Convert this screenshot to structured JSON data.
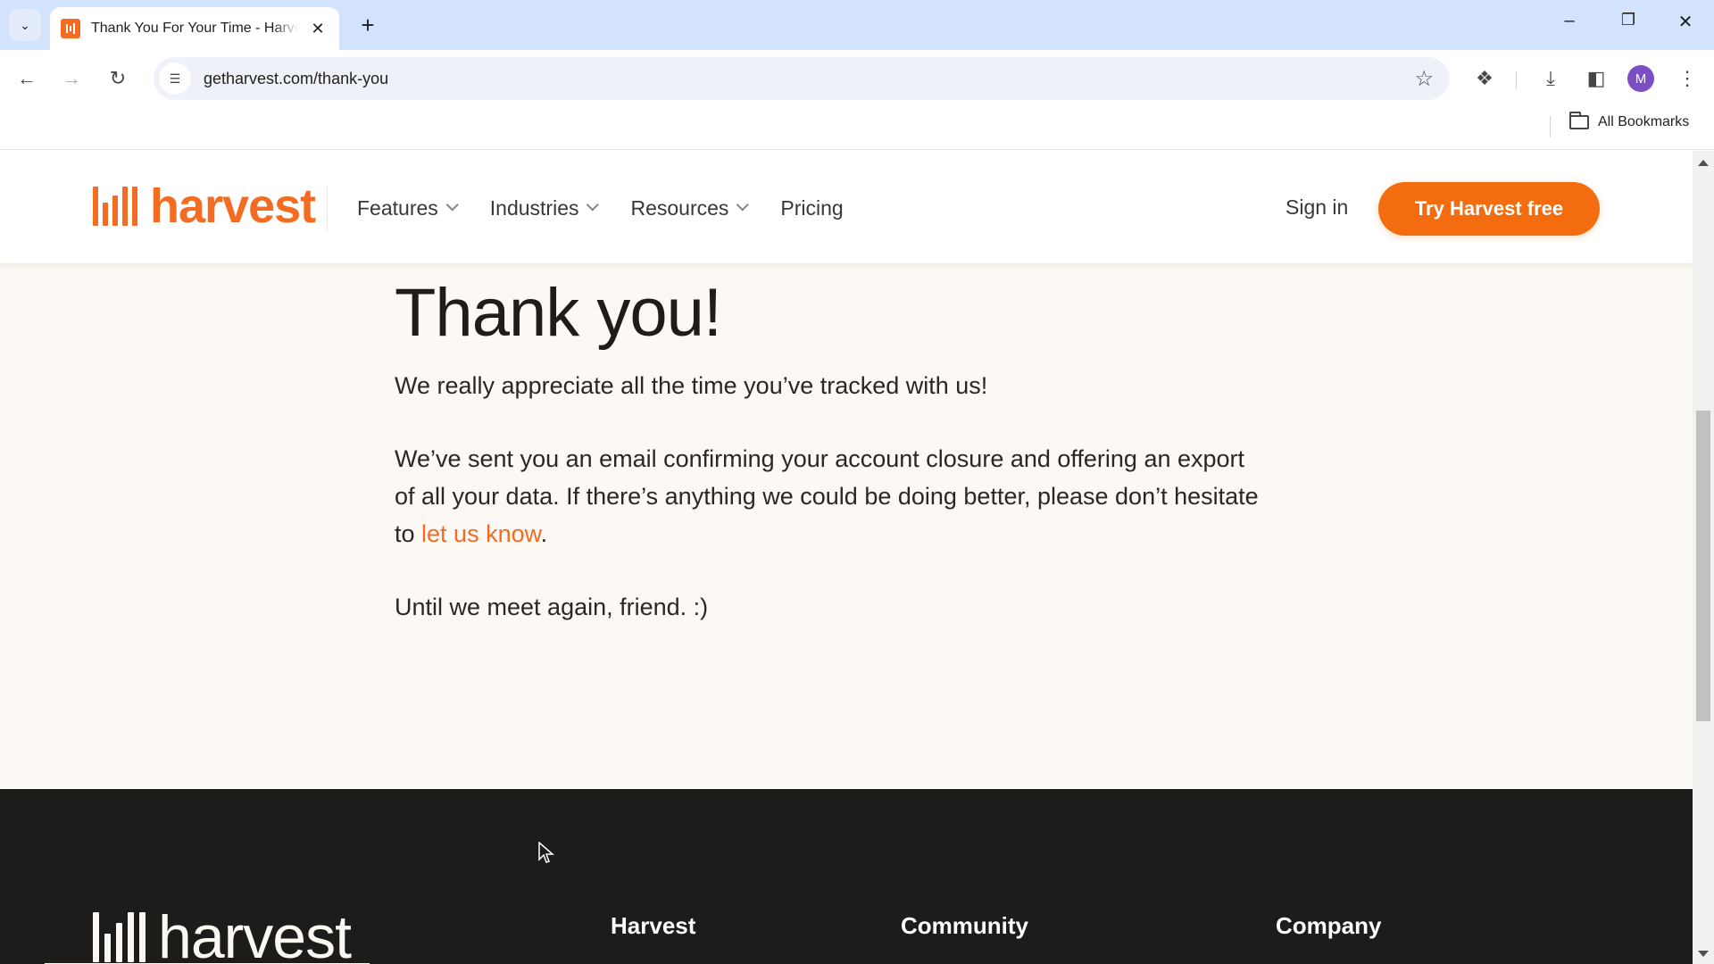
{
  "browser": {
    "tab": {
      "title": "Thank You For Your Time - Harvest"
    },
    "url": "getharvest.com/thank-you",
    "bookmarks_label": "All Bookmarks",
    "profile_initial": "M"
  },
  "header": {
    "logo_text": "harvest",
    "nav": [
      {
        "label": "Features",
        "has_dropdown": true
      },
      {
        "label": "Industries",
        "has_dropdown": true
      },
      {
        "label": "Resources",
        "has_dropdown": true
      },
      {
        "label": "Pricing",
        "has_dropdown": false
      }
    ],
    "sign_in": "Sign in",
    "cta": "Try Harvest free"
  },
  "main": {
    "heading": "Thank you!",
    "intro": "We really appreciate all the time you’ve tracked with us!",
    "body_before_link": "We’ve sent you an email confirming your account closure and offering an export of all your data. If there’s anything we could be doing better, please don’t hesitate to ",
    "link_text": "let us know",
    "body_after_link": ".",
    "closing": "Until we meet again, friend. :)"
  },
  "footer": {
    "logo_text": "harvest",
    "columns": [
      "Harvest",
      "Community",
      "Company"
    ]
  },
  "colors": {
    "brand_orange": "#f36c21",
    "cta_orange": "#f36c0f",
    "page_bg": "#fcf8f3",
    "footer_bg": "#1e1c1b"
  }
}
